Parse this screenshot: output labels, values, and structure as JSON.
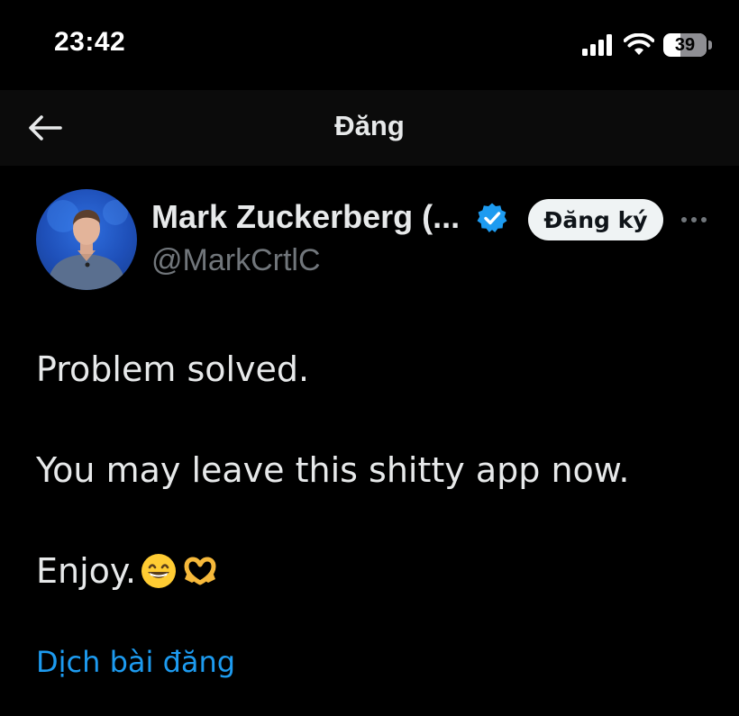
{
  "status_bar": {
    "time": "23:42",
    "signal_icon": "cellular-signal-icon",
    "wifi_icon": "wifi-icon",
    "battery_level": "39",
    "battery_percent": 39
  },
  "header": {
    "back_icon": "arrow-left-icon",
    "title": "Đăng"
  },
  "post": {
    "avatar": "avatar",
    "author_name": "Mark Zuckerberg (...",
    "verified_icon": "verified-badge-icon",
    "verified_color": "#1d9bf0",
    "handle": "@MarkCrtlC",
    "subscribe_label": "Đăng ký",
    "more_icon": "more-dots-icon",
    "text_line_1": "Problem solved.",
    "text_line_2": "You may leave this shitty app now.",
    "text_line_3": "Enjoy.",
    "emojis": [
      "grinning-face-icon",
      "heart-hands-icon"
    ],
    "translate_label": "Dịch bài đăng"
  },
  "colors": {
    "background": "#000000",
    "header_background": "#0b0b0b",
    "primary_text": "#e7e9ea",
    "secondary_text": "#71767b",
    "accent": "#1d9bf0"
  }
}
